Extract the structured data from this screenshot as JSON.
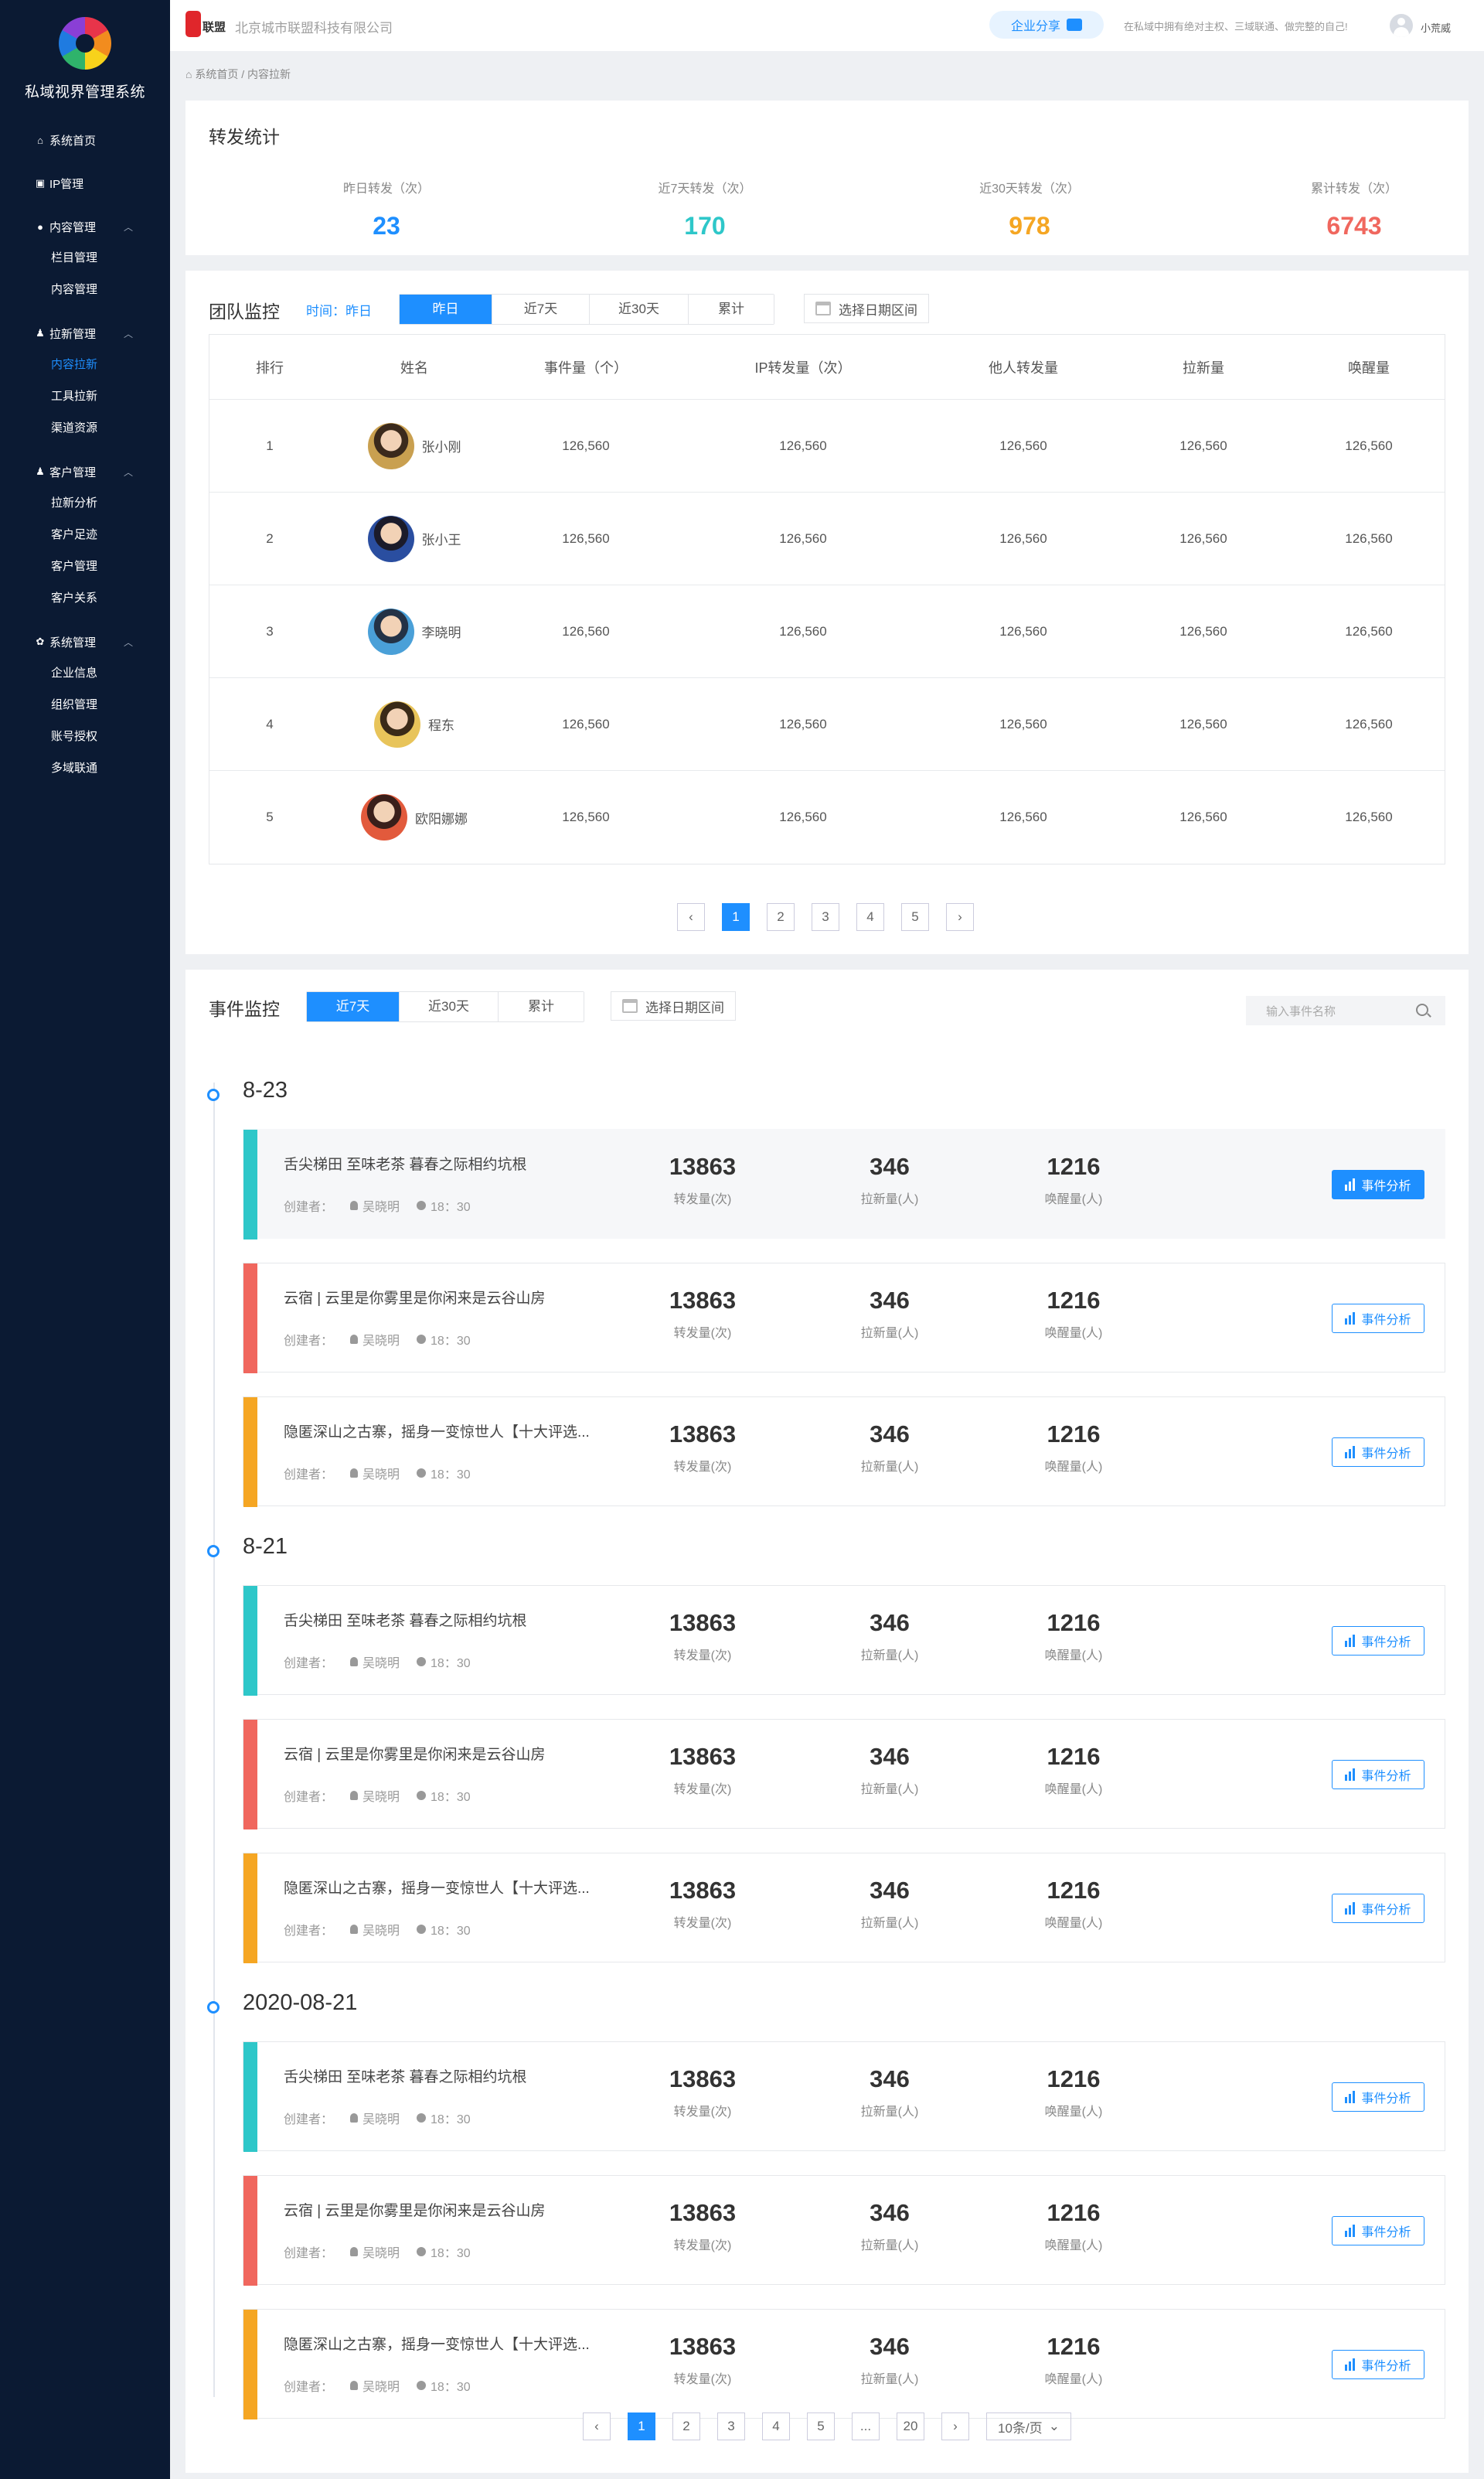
{
  "sidebar": {
    "title": "私域视界管理系统",
    "groups": [
      {
        "label": "系统首页",
        "icon": "home-icon",
        "glyph": "⌂",
        "expandable": false,
        "items": []
      },
      {
        "label": "IP管理",
        "icon": "ip-icon",
        "glyph": "▣",
        "expandable": false,
        "items": []
      },
      {
        "label": "内容管理",
        "icon": "content-icon",
        "glyph": "●",
        "expandable": true,
        "items": [
          "栏目管理",
          "内容管理"
        ]
      },
      {
        "label": "拉新管理",
        "icon": "user-icon",
        "glyph": "♟",
        "expandable": true,
        "items": [
          "内容拉新",
          "工具拉新",
          "渠道资源"
        ]
      },
      {
        "label": "客户管理",
        "icon": "customer-icon",
        "glyph": "♟",
        "expandable": true,
        "items": [
          "拉新分析",
          "客户足迹",
          "客户管理",
          "客户关系"
        ]
      },
      {
        "label": "系统管理",
        "icon": "gear-icon",
        "glyph": "✿",
        "expandable": true,
        "items": [
          "企业信息",
          "组织管理",
          "账号授权",
          "多域联通"
        ]
      }
    ],
    "active": "内容拉新"
  },
  "topbar": {
    "brand": "联盟",
    "company": "北京城市联盟科技有限公司",
    "share_label": "企业分享",
    "slogan": "在私域中拥有绝对主权、三域联通、做完整的自己!",
    "user": "小荒威"
  },
  "breadcrumb": {
    "home": "系统首页",
    "sep": " / ",
    "current": "内容拉新"
  },
  "forward_stats": {
    "title": "转发统计",
    "items": [
      {
        "label": "昨日转发（次）",
        "value": "23",
        "color": "#1e8fff"
      },
      {
        "label": "近7天转发（次）",
        "value": "170",
        "color": "#2ec7c9"
      },
      {
        "label": "近30天转发（次）",
        "value": "978",
        "color": "#f5a623"
      },
      {
        "label": "累计转发（次）",
        "value": "6743",
        "color": "#f0675e"
      }
    ]
  },
  "team": {
    "title": "团队监控",
    "time_label": "时间：昨日",
    "tabs": [
      "昨日",
      "近7天",
      "近30天",
      "累计"
    ],
    "active_tab": 0,
    "date_range": "选择日期区间",
    "columns": [
      "排行",
      "姓名",
      "事件量（个）",
      "IP转发量（次）",
      "他人转发量",
      "拉新量",
      "唤醒量"
    ],
    "rows": [
      {
        "rank": "1",
        "name": "张小刚",
        "c1": "126,560",
        "c2": "126,560",
        "c3": "126,560",
        "c4": "126,560",
        "c5": "126,560"
      },
      {
        "rank": "2",
        "name": "张小王",
        "c1": "126,560",
        "c2": "126,560",
        "c3": "126,560",
        "c4": "126,560",
        "c5": "126,560"
      },
      {
        "rank": "3",
        "name": "李晓明",
        "c1": "126,560",
        "c2": "126,560",
        "c3": "126,560",
        "c4": "126,560",
        "c5": "126,560"
      },
      {
        "rank": "4",
        "name": "程东",
        "c1": "126,560",
        "c2": "126,560",
        "c3": "126,560",
        "c4": "126,560",
        "c5": "126,560"
      },
      {
        "rank": "5",
        "name": "欧阳娜娜",
        "c1": "126,560",
        "c2": "126,560",
        "c3": "126,560",
        "c4": "126,560",
        "c5": "126,560"
      }
    ],
    "pager": {
      "prev": "‹",
      "pages": [
        "1",
        "2",
        "3",
        "4",
        "5"
      ],
      "next": "›",
      "active": 0
    }
  },
  "events": {
    "title": "事件监控",
    "tabs": [
      "近7天",
      "近30天",
      "累计"
    ],
    "active_tab": 0,
    "date_range": "选择日期区间",
    "search_placeholder": "输入事件名称",
    "metric_units": [
      "转发量(次)",
      "拉新量(人)",
      "唤醒量(人)"
    ],
    "creator_label": "创建者：",
    "analysis_label": "事件分析",
    "groups": [
      {
        "date": "8-23",
        "items": [
          {
            "title": "舌尖梯田 至味老茶  暮春之际相约坑根",
            "creator": "吴晓明",
            "time": "18：30",
            "forward": "13863",
            "newcomers": "346",
            "awaken": "1216",
            "color": "#2ec7c9"
          },
          {
            "title": "云宿 | 云里是你雾里是你闲来是云谷山房",
            "creator": "吴晓明",
            "time": "18：30",
            "forward": "13863",
            "newcomers": "346",
            "awaken": "1216",
            "color": "#f0675e"
          },
          {
            "title": "隐匿深山之古寨，摇身一变惊世人【十大评选...",
            "creator": "吴晓明",
            "time": "18：30",
            "forward": "13863",
            "newcomers": "346",
            "awaken": "1216",
            "color": "#f5a623"
          }
        ]
      },
      {
        "date": "8-21",
        "items": [
          {
            "title": "舌尖梯田 至味老茶  暮春之际相约坑根",
            "creator": "吴晓明",
            "time": "18：30",
            "forward": "13863",
            "newcomers": "346",
            "awaken": "1216",
            "color": "#2ec7c9"
          },
          {
            "title": "云宿 | 云里是你雾里是你闲来是云谷山房",
            "creator": "吴晓明",
            "time": "18：30",
            "forward": "13863",
            "newcomers": "346",
            "awaken": "1216",
            "color": "#f0675e"
          },
          {
            "title": "隐匿深山之古寨，摇身一变惊世人【十大评选...",
            "creator": "吴晓明",
            "time": "18：30",
            "forward": "13863",
            "newcomers": "346",
            "awaken": "1216",
            "color": "#f5a623"
          }
        ]
      },
      {
        "date": "2020-08-21",
        "items": [
          {
            "title": "舌尖梯田 至味老茶  暮春之际相约坑根",
            "creator": "吴晓明",
            "time": "18：30",
            "forward": "13863",
            "newcomers": "346",
            "awaken": "1216",
            "color": "#2ec7c9"
          },
          {
            "title": "云宿 | 云里是你雾里是你闲来是云谷山房",
            "creator": "吴晓明",
            "time": "18：30",
            "forward": "13863",
            "newcomers": "346",
            "awaken": "1216",
            "color": "#f0675e"
          },
          {
            "title": "隐匿深山之古寨，摇身一变惊世人【十大评选...",
            "creator": "吴晓明",
            "time": "18：30",
            "forward": "13863",
            "newcomers": "346",
            "awaken": "1216",
            "color": "#f5a623"
          }
        ]
      }
    ],
    "pager": {
      "prev": "‹",
      "pages": [
        "1",
        "2",
        "3",
        "4",
        "5",
        "...",
        "20"
      ],
      "next": "›",
      "active": 0,
      "page_size": "10条/页"
    }
  }
}
